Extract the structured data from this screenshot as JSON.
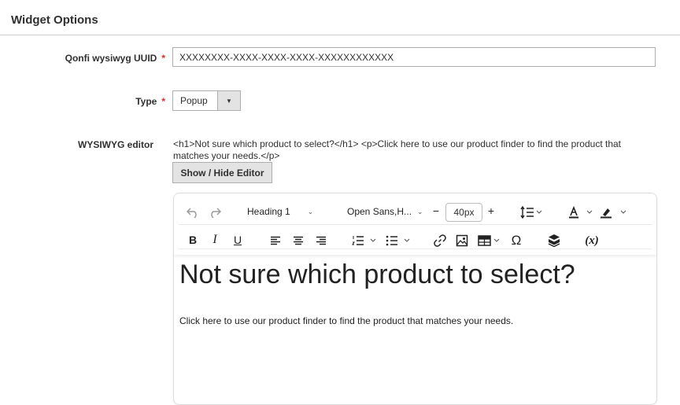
{
  "section": {
    "title": "Widget Options"
  },
  "fields": {
    "uuid": {
      "label": "Qonfi wysiwyg UUID",
      "required_mark": "*",
      "value": "XXXXXXXX-XXXX-XXXX-XXXX-XXXXXXXXXXXX"
    },
    "type": {
      "label": "Type",
      "required_mark": "*",
      "selected": "Popup"
    },
    "editor": {
      "label": "WYSIWYG editor",
      "raw_content": "<h1>Not sure which product to select?</h1> <p>Click here to use our product finder to find the product that matches your needs.</p>",
      "toggle_label": "Show / Hide Editor"
    }
  },
  "toolbar": {
    "block_format": "Heading 1",
    "font_family": "Open Sans,H...",
    "font_size": "40px",
    "decrease": "−",
    "increase": "+",
    "bold": "B",
    "italic": "I",
    "underline": "U",
    "omega": "Ω",
    "variable": "(x)"
  },
  "content": {
    "heading": "Not sure which product to select?",
    "paragraph": "Click here to use our product finder to find the product that matches your needs."
  }
}
